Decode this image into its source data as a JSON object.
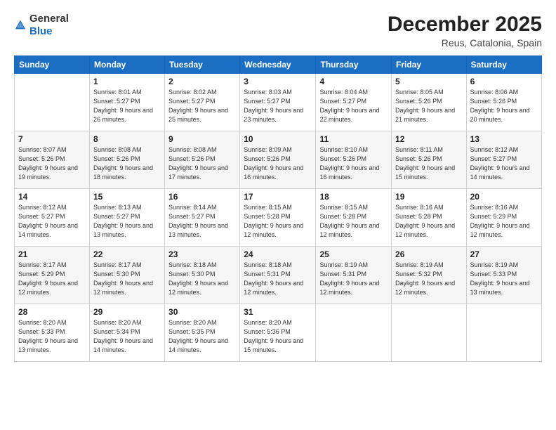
{
  "header": {
    "logo_general": "General",
    "logo_blue": "Blue",
    "month": "December 2025",
    "location": "Reus, Catalonia, Spain"
  },
  "days_of_week": [
    "Sunday",
    "Monday",
    "Tuesday",
    "Wednesday",
    "Thursday",
    "Friday",
    "Saturday"
  ],
  "weeks": [
    [
      {
        "day": "",
        "sunrise": "",
        "sunset": "",
        "daylight": ""
      },
      {
        "day": "1",
        "sunrise": "Sunrise: 8:01 AM",
        "sunset": "Sunset: 5:27 PM",
        "daylight": "Daylight: 9 hours and 26 minutes."
      },
      {
        "day": "2",
        "sunrise": "Sunrise: 8:02 AM",
        "sunset": "Sunset: 5:27 PM",
        "daylight": "Daylight: 9 hours and 25 minutes."
      },
      {
        "day": "3",
        "sunrise": "Sunrise: 8:03 AM",
        "sunset": "Sunset: 5:27 PM",
        "daylight": "Daylight: 9 hours and 23 minutes."
      },
      {
        "day": "4",
        "sunrise": "Sunrise: 8:04 AM",
        "sunset": "Sunset: 5:27 PM",
        "daylight": "Daylight: 9 hours and 22 minutes."
      },
      {
        "day": "5",
        "sunrise": "Sunrise: 8:05 AM",
        "sunset": "Sunset: 5:26 PM",
        "daylight": "Daylight: 9 hours and 21 minutes."
      },
      {
        "day": "6",
        "sunrise": "Sunrise: 8:06 AM",
        "sunset": "Sunset: 5:26 PM",
        "daylight": "Daylight: 9 hours and 20 minutes."
      }
    ],
    [
      {
        "day": "7",
        "sunrise": "Sunrise: 8:07 AM",
        "sunset": "Sunset: 5:26 PM",
        "daylight": "Daylight: 9 hours and 19 minutes."
      },
      {
        "day": "8",
        "sunrise": "Sunrise: 8:08 AM",
        "sunset": "Sunset: 5:26 PM",
        "daylight": "Daylight: 9 hours and 18 minutes."
      },
      {
        "day": "9",
        "sunrise": "Sunrise: 8:08 AM",
        "sunset": "Sunset: 5:26 PM",
        "daylight": "Daylight: 9 hours and 17 minutes."
      },
      {
        "day": "10",
        "sunrise": "Sunrise: 8:09 AM",
        "sunset": "Sunset: 5:26 PM",
        "daylight": "Daylight: 9 hours and 16 minutes."
      },
      {
        "day": "11",
        "sunrise": "Sunrise: 8:10 AM",
        "sunset": "Sunset: 5:26 PM",
        "daylight": "Daylight: 9 hours and 16 minutes."
      },
      {
        "day": "12",
        "sunrise": "Sunrise: 8:11 AM",
        "sunset": "Sunset: 5:26 PM",
        "daylight": "Daylight: 9 hours and 15 minutes."
      },
      {
        "day": "13",
        "sunrise": "Sunrise: 8:12 AM",
        "sunset": "Sunset: 5:27 PM",
        "daylight": "Daylight: 9 hours and 14 minutes."
      }
    ],
    [
      {
        "day": "14",
        "sunrise": "Sunrise: 8:12 AM",
        "sunset": "Sunset: 5:27 PM",
        "daylight": "Daylight: 9 hours and 14 minutes."
      },
      {
        "day": "15",
        "sunrise": "Sunrise: 8:13 AM",
        "sunset": "Sunset: 5:27 PM",
        "daylight": "Daylight: 9 hours and 13 minutes."
      },
      {
        "day": "16",
        "sunrise": "Sunrise: 8:14 AM",
        "sunset": "Sunset: 5:27 PM",
        "daylight": "Daylight: 9 hours and 13 minutes."
      },
      {
        "day": "17",
        "sunrise": "Sunrise: 8:15 AM",
        "sunset": "Sunset: 5:28 PM",
        "daylight": "Daylight: 9 hours and 12 minutes."
      },
      {
        "day": "18",
        "sunrise": "Sunrise: 8:15 AM",
        "sunset": "Sunset: 5:28 PM",
        "daylight": "Daylight: 9 hours and 12 minutes."
      },
      {
        "day": "19",
        "sunrise": "Sunrise: 8:16 AM",
        "sunset": "Sunset: 5:28 PM",
        "daylight": "Daylight: 9 hours and 12 minutes."
      },
      {
        "day": "20",
        "sunrise": "Sunrise: 8:16 AM",
        "sunset": "Sunset: 5:29 PM",
        "daylight": "Daylight: 9 hours and 12 minutes."
      }
    ],
    [
      {
        "day": "21",
        "sunrise": "Sunrise: 8:17 AM",
        "sunset": "Sunset: 5:29 PM",
        "daylight": "Daylight: 9 hours and 12 minutes."
      },
      {
        "day": "22",
        "sunrise": "Sunrise: 8:17 AM",
        "sunset": "Sunset: 5:30 PM",
        "daylight": "Daylight: 9 hours and 12 minutes."
      },
      {
        "day": "23",
        "sunrise": "Sunrise: 8:18 AM",
        "sunset": "Sunset: 5:30 PM",
        "daylight": "Daylight: 9 hours and 12 minutes."
      },
      {
        "day": "24",
        "sunrise": "Sunrise: 8:18 AM",
        "sunset": "Sunset: 5:31 PM",
        "daylight": "Daylight: 9 hours and 12 minutes."
      },
      {
        "day": "25",
        "sunrise": "Sunrise: 8:19 AM",
        "sunset": "Sunset: 5:31 PM",
        "daylight": "Daylight: 9 hours and 12 minutes."
      },
      {
        "day": "26",
        "sunrise": "Sunrise: 8:19 AM",
        "sunset": "Sunset: 5:32 PM",
        "daylight": "Daylight: 9 hours and 12 minutes."
      },
      {
        "day": "27",
        "sunrise": "Sunrise: 8:19 AM",
        "sunset": "Sunset: 5:33 PM",
        "daylight": "Daylight: 9 hours and 13 minutes."
      }
    ],
    [
      {
        "day": "28",
        "sunrise": "Sunrise: 8:20 AM",
        "sunset": "Sunset: 5:33 PM",
        "daylight": "Daylight: 9 hours and 13 minutes."
      },
      {
        "day": "29",
        "sunrise": "Sunrise: 8:20 AM",
        "sunset": "Sunset: 5:34 PM",
        "daylight": "Daylight: 9 hours and 14 minutes."
      },
      {
        "day": "30",
        "sunrise": "Sunrise: 8:20 AM",
        "sunset": "Sunset: 5:35 PM",
        "daylight": "Daylight: 9 hours and 14 minutes."
      },
      {
        "day": "31",
        "sunrise": "Sunrise: 8:20 AM",
        "sunset": "Sunset: 5:36 PM",
        "daylight": "Daylight: 9 hours and 15 minutes."
      },
      {
        "day": "",
        "sunrise": "",
        "sunset": "",
        "daylight": ""
      },
      {
        "day": "",
        "sunrise": "",
        "sunset": "",
        "daylight": ""
      },
      {
        "day": "",
        "sunrise": "",
        "sunset": "",
        "daylight": ""
      }
    ]
  ]
}
